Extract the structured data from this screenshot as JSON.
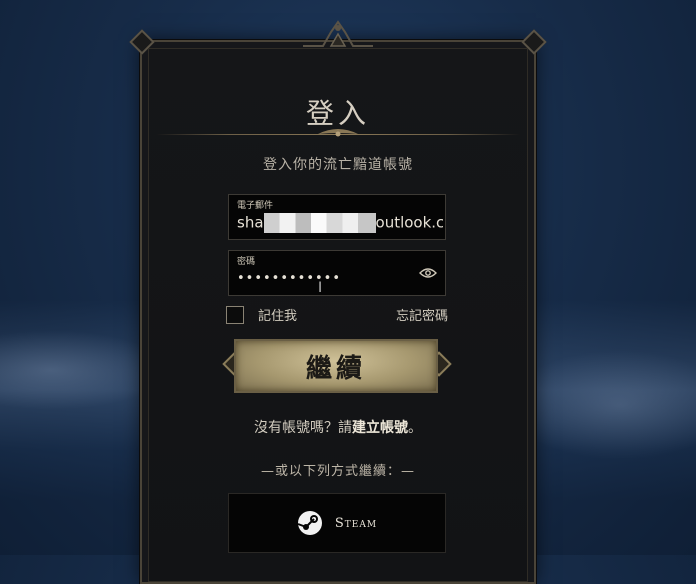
{
  "dialog": {
    "title": "登入",
    "subtitle": "登入你的流亡黯道帳號"
  },
  "email": {
    "label": "電子郵件",
    "value_prefix": "sha",
    "value_suffix": "outlook.c"
  },
  "password": {
    "label": "密碼",
    "masked_value": "••••••••••••"
  },
  "remember": {
    "label": "記住我",
    "checked": false
  },
  "forgot": {
    "label": "忘記密碼"
  },
  "continue_button": {
    "label": "繼續"
  },
  "signup": {
    "prefix": "沒有帳號嗎？請",
    "link": "建立帳號",
    "suffix": "。"
  },
  "alternative": {
    "label": "—或以下列方式繼續：—"
  },
  "steam_button": {
    "label": "Steam",
    "icon": "steam-icon"
  },
  "colors": {
    "background": "#172c49",
    "panel": "#16171a",
    "gold": "#a6986f"
  }
}
